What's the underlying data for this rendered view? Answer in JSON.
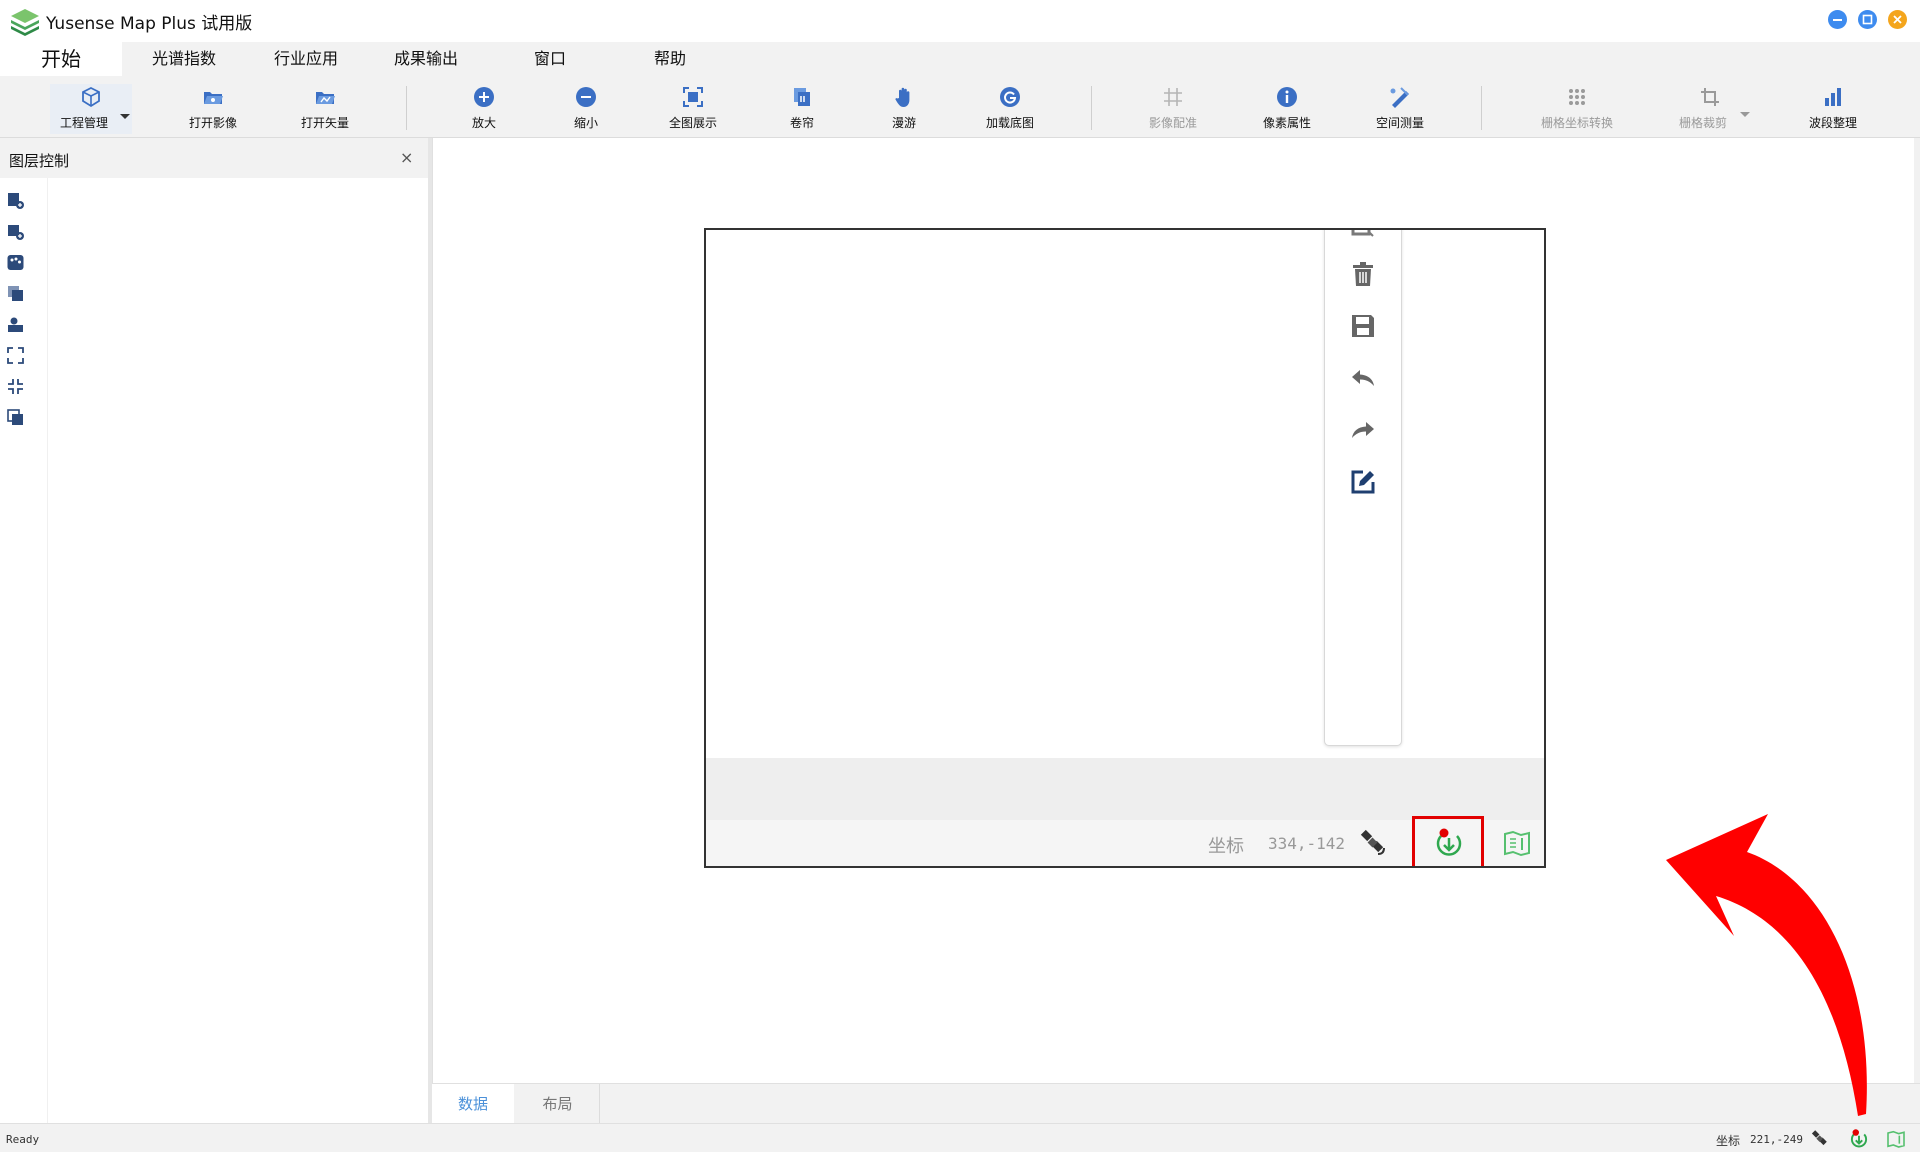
{
  "window": {
    "title": "Yusense Map Plus 试用版"
  },
  "menu": {
    "tabs": [
      "开始",
      "光谱指数",
      "行业应用",
      "成果输出",
      "窗口",
      "帮助"
    ]
  },
  "ribbon": {
    "buttons": [
      {
        "label": "工程管理",
        "icon": "cube-icon"
      },
      {
        "label": "打开影像",
        "icon": "folder-image-icon"
      },
      {
        "label": "打开矢量",
        "icon": "folder-vector-icon"
      },
      {
        "label": "放大",
        "icon": "zoom-in-icon"
      },
      {
        "label": "缩小",
        "icon": "zoom-out-icon"
      },
      {
        "label": "全图展示",
        "icon": "full-extent-icon"
      },
      {
        "label": "卷帘",
        "icon": "swipe-icon"
      },
      {
        "label": "漫游",
        "icon": "hand-icon"
      },
      {
        "label": "加载底图",
        "icon": "basemap-icon"
      },
      {
        "label": "影像配准",
        "icon": "georeference-icon"
      },
      {
        "label": "像素属性",
        "icon": "info-icon"
      },
      {
        "label": "空间测量",
        "icon": "measure-icon"
      },
      {
        "label": "栅格坐标转换",
        "icon": "grid-dots-icon"
      },
      {
        "label": "栅格裁剪",
        "icon": "crop-icon"
      },
      {
        "label": "波段整理",
        "icon": "bar-chart-icon"
      }
    ]
  },
  "layer_panel": {
    "title": "图层控制",
    "close": "×",
    "tools": [
      "add-layer-icon",
      "add-vector-icon",
      "palette-icon",
      "copy-layer-icon",
      "style-icon",
      "expand-icon",
      "collapse-icon",
      "duplicate-icon"
    ]
  },
  "screenshot": {
    "toolbar_icons": [
      "edit-partial-icon",
      "trash-icon",
      "save-icon",
      "undo-icon",
      "redo-icon",
      "edit-icon"
    ],
    "status": {
      "label": "坐标",
      "coord": "334,-142"
    }
  },
  "bottom_tabs": [
    "数据",
    "布局"
  ],
  "statusbar": {
    "ready": "Ready",
    "coord_label": "坐标",
    "coord": "221,-249"
  },
  "colors": {
    "accent": "#3b6fc4",
    "highlight": "#e20000",
    "green": "#2fa84f"
  }
}
